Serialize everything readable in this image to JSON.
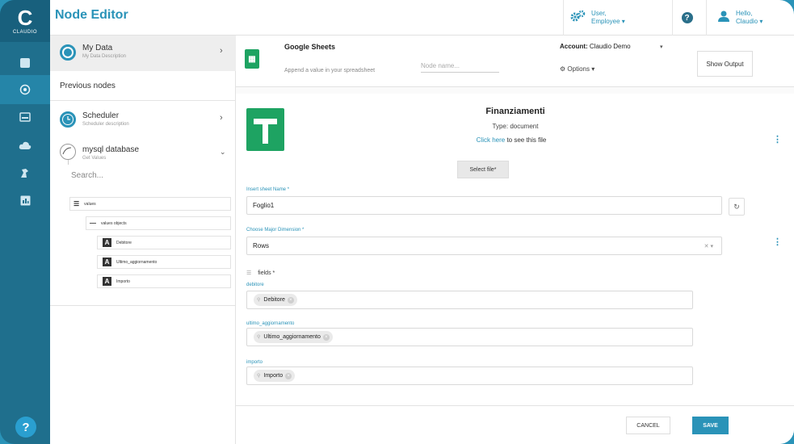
{
  "app": {
    "title": "Node Editor",
    "logo_brand": "CLAUDIO",
    "help_label": "?"
  },
  "header": {
    "user_role_label": "User,",
    "user_role_value": "Employee ▾",
    "help_glyph": "?",
    "hello_label": "Hello,",
    "hello_name": "Claudio ▾"
  },
  "rail": {
    "icons": [
      "dashboard-icon",
      "nodes-icon",
      "storage-icon",
      "cloud-icon",
      "robot-icon",
      "chart-icon"
    ],
    "active_index": 1
  },
  "left_panel": {
    "my_data": {
      "title": "My Data",
      "subtitle": "My Data Description"
    },
    "previous_nodes_label": "Previous nodes",
    "scheduler": {
      "title": "Scheduler",
      "subtitle": "Scheduler description"
    },
    "mysql": {
      "title": "mysql database",
      "subtitle": "Get Values"
    },
    "search_placeholder": "Search...",
    "tree": {
      "root": "values",
      "child": "values objects",
      "leaves": [
        "Debitore",
        "Ultimo_aggiornamento",
        "Importo"
      ]
    }
  },
  "node": {
    "name": "Google Sheets",
    "description": "Append a value in your spreadsheet",
    "name_placeholder": "Node name...",
    "account_label": "Account:",
    "account_value": "Claudio Demo",
    "options_label": "Options",
    "show_output_label": "Show Output"
  },
  "file": {
    "title": "Finanziamenti",
    "type_text": "Type: document",
    "link_text": "Click here",
    "link_suffix": " to see this file",
    "select_file_label": "Select file*"
  },
  "form": {
    "sheet_name_label": "Insert sheet Name *",
    "sheet_name_value": "Foglio1",
    "dimension_label": "Choose Major Dimension *",
    "dimension_value": "Rows",
    "fields_label": "fields *",
    "fields": [
      {
        "label": "debitore",
        "chip": "Debitore"
      },
      {
        "label": "ultimo_aggiornamento",
        "chip": "Ultimo_aggiornamento"
      },
      {
        "label": "importo",
        "chip": "Importo"
      }
    ]
  },
  "footer": {
    "cancel_label": "CANCEL",
    "save_label": "SAVE"
  },
  "colors": {
    "accent": "#2a93b8",
    "sheets_green": "#1ea362",
    "rail": "#1f6f8d"
  }
}
